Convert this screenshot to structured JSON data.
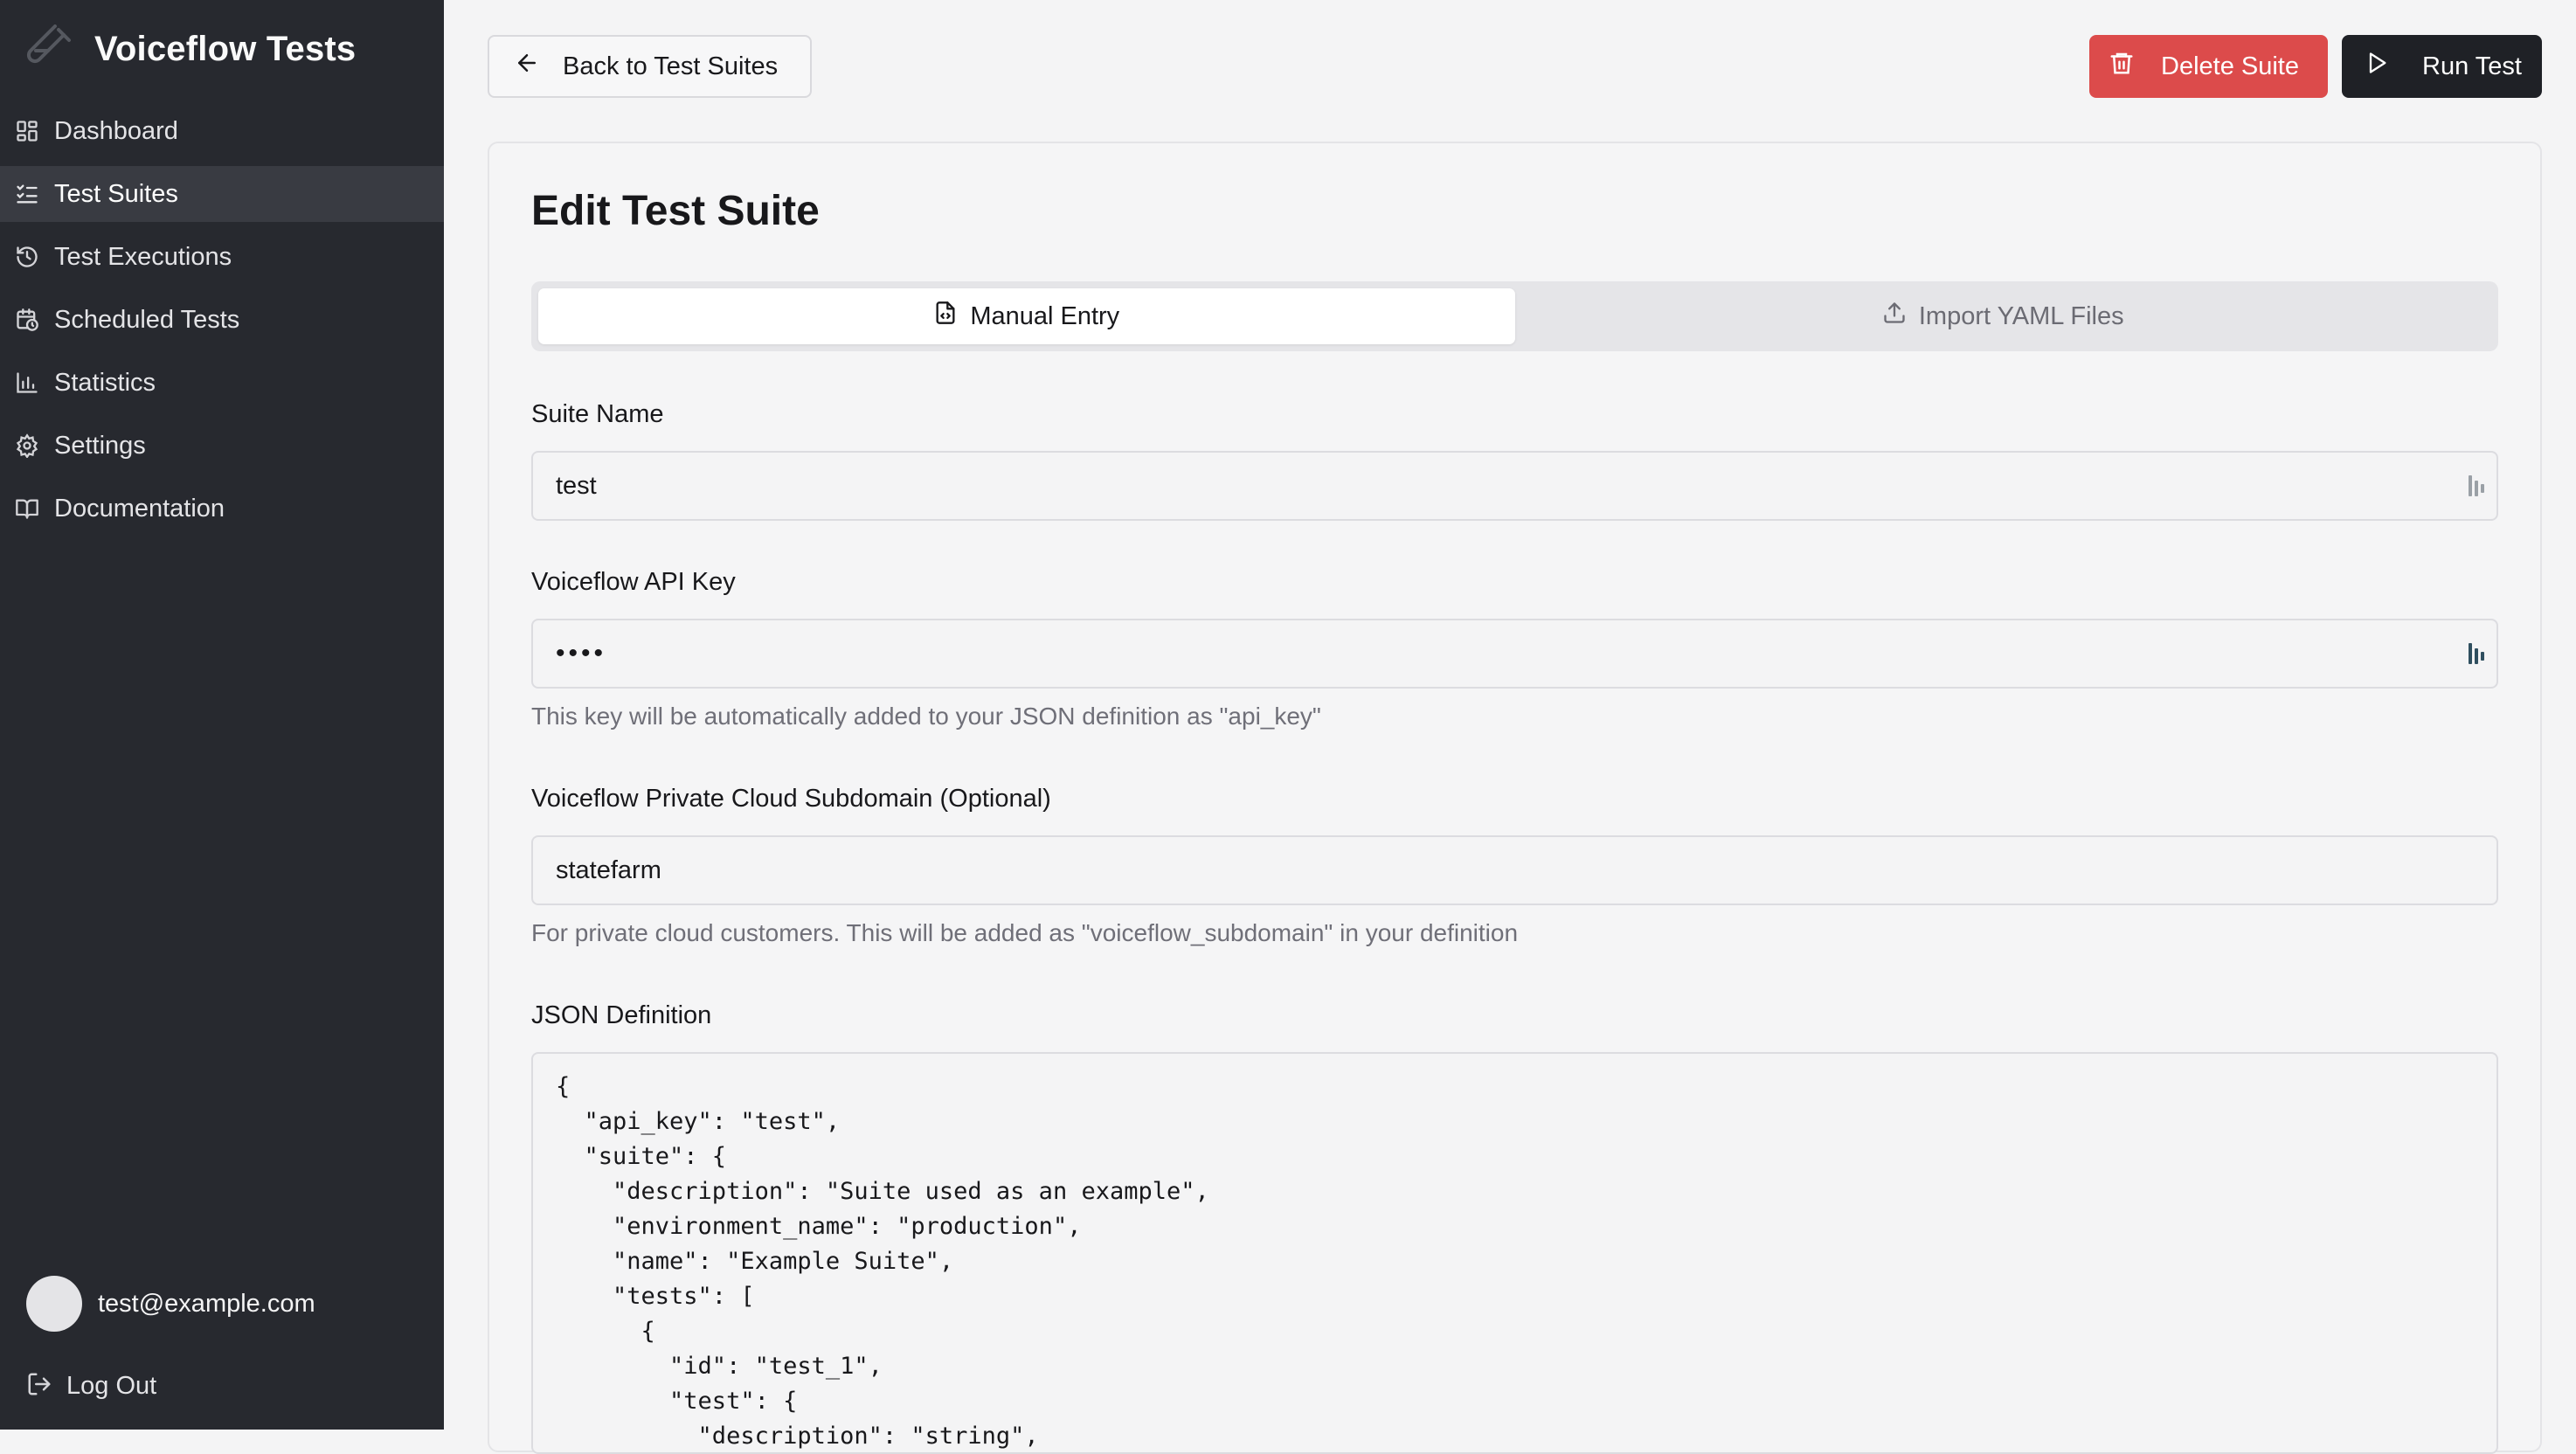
{
  "app": {
    "title": "Voiceflow Tests"
  },
  "sidebar": {
    "items": [
      {
        "label": "Dashboard",
        "icon": "grid-icon"
      },
      {
        "label": "Test Suites",
        "icon": "list-check-icon",
        "active": true
      },
      {
        "label": "Test Executions",
        "icon": "history-icon"
      },
      {
        "label": "Scheduled Tests",
        "icon": "calendar-clock-icon"
      },
      {
        "label": "Statistics",
        "icon": "bar-chart-icon"
      },
      {
        "label": "Settings",
        "icon": "gear-icon"
      },
      {
        "label": "Documentation",
        "icon": "book-open-icon"
      }
    ],
    "user_email": "test@example.com",
    "logout_label": "Log Out"
  },
  "toolbar": {
    "back_label": "Back to Test Suites",
    "delete_label": "Delete Suite",
    "run_label": "Run Test"
  },
  "colors": {
    "sidebar_bg": "#27292f",
    "delete_red": "#dc4b4b",
    "run_dark": "#1f2126",
    "page_bg": "#f4f4f5"
  },
  "form": {
    "title": "Edit Test Suite",
    "tabs": [
      {
        "label": "Manual Entry",
        "icon": "file-code-icon",
        "active": true
      },
      {
        "label": "Import YAML Files",
        "icon": "upload-icon",
        "active": false
      }
    ],
    "suite_name": {
      "label": "Suite Name",
      "value": "test"
    },
    "api_key": {
      "label": "Voiceflow API Key",
      "value": "••••",
      "help": "This key will be automatically added to your JSON definition as \"api_key\""
    },
    "subdomain": {
      "label": "Voiceflow Private Cloud Subdomain (Optional)",
      "value": "statefarm",
      "help": "For private cloud customers. This will be added as \"voiceflow_subdomain\" in your definition"
    },
    "json_definition": {
      "label": "JSON Definition",
      "lines": [
        "{",
        "  \"api_key\": \"test\",",
        "  \"suite\": {",
        "    \"description\": \"Suite used as an example\",",
        "    \"environment_name\": \"production\",",
        "    \"name\": \"Example Suite\",",
        "    \"tests\": [",
        "      {",
        "        \"id\": \"test_1\",",
        "        \"test\": {",
        "          \"description\": \"string\","
      ]
    }
  }
}
